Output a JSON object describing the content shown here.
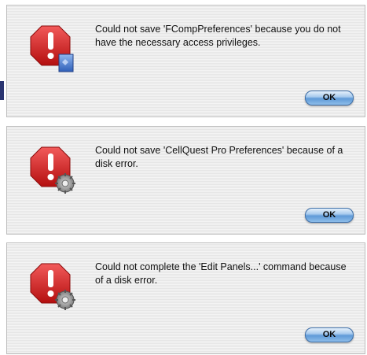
{
  "dialogs": [
    {
      "message": "Could not save 'FCompPreferences' because you do not have the necessary access privileges.",
      "ok_label": "OK",
      "badge_icon": "document-icon"
    },
    {
      "message": "Could not save 'CellQuest Pro Preferences' because of a disk error.",
      "ok_label": "OK",
      "badge_icon": "gear-icon"
    },
    {
      "message": "Could not complete the 'Edit Panels...' command because of a disk error.",
      "ok_label": "OK",
      "badge_icon": "gear-icon"
    }
  ],
  "colors": {
    "stop_red": "#d21f1f",
    "button_blue": "#5f9ad8"
  }
}
